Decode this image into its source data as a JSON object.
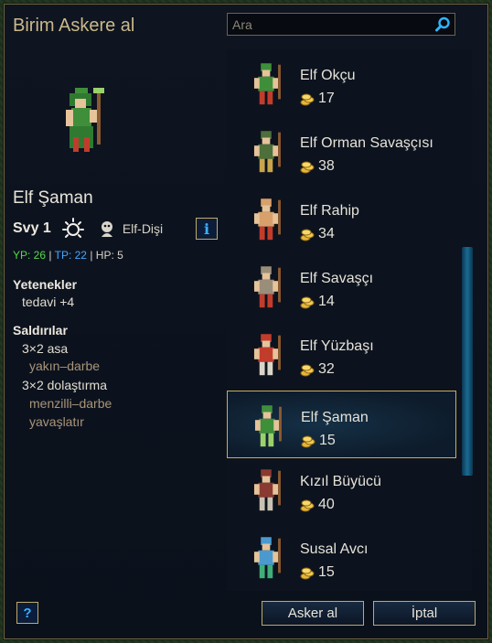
{
  "dialog": {
    "title": "Birim Askere al"
  },
  "search": {
    "placeholder": "Ara"
  },
  "selected_unit": {
    "name": "Elf Şaman",
    "level": "Svy 1",
    "race": "Elf-Dişi",
    "stats": {
      "hp_label": "YP: 26",
      "tp_label": "TP: 22",
      "xp_label": "HP: 5",
      "sep": "|"
    },
    "abilities_heading": "Yetenekler",
    "abilities": [
      "tedavi +4"
    ],
    "attacks_heading": "Saldırılar",
    "attacks": [
      {
        "name": "3×2 asa",
        "details": [
          "yakın–darbe"
        ]
      },
      {
        "name": "3×2 dolaştırma",
        "details": [
          "menzilli–darbe",
          "yavaşlatır"
        ]
      }
    ],
    "info_button": "i"
  },
  "recruit_list": [
    {
      "name": "Elf Okçu",
      "cost": "17",
      "palette": "#3f8f3a",
      "accent": "#c23c2c"
    },
    {
      "name": "Elf Orman Savaşçısı",
      "cost": "38",
      "palette": "#4d6f3a",
      "accent": "#c9a44a"
    },
    {
      "name": "Elf Rahip",
      "cost": "34",
      "palette": "#d8a06a",
      "accent": "#c23c2c"
    },
    {
      "name": "Elf Savaşçı",
      "cost": "14",
      "palette": "#9a8e7a",
      "accent": "#c23c2c"
    },
    {
      "name": "Elf Yüzbaşı",
      "cost": "32",
      "palette": "#c23c2c",
      "accent": "#d9d5c8"
    },
    {
      "name": "Elf Şaman",
      "cost": "15",
      "palette": "#3f8f3a",
      "accent": "#9bd16b",
      "selected": true
    },
    {
      "name": "Kızıl Büyücü",
      "cost": "40",
      "palette": "#8a3a30",
      "accent": "#c9c3b2"
    },
    {
      "name": "Susal Avcı",
      "cost": "15",
      "palette": "#4a9ad0",
      "accent": "#3fae7a"
    }
  ],
  "buttons": {
    "help": "?",
    "recruit": "Asker al",
    "cancel": "İptal"
  },
  "colors": {
    "gold_border": "#bfa96a",
    "title": "#c9b88a",
    "hp": "#55d94a",
    "tp": "#45a6ff"
  }
}
